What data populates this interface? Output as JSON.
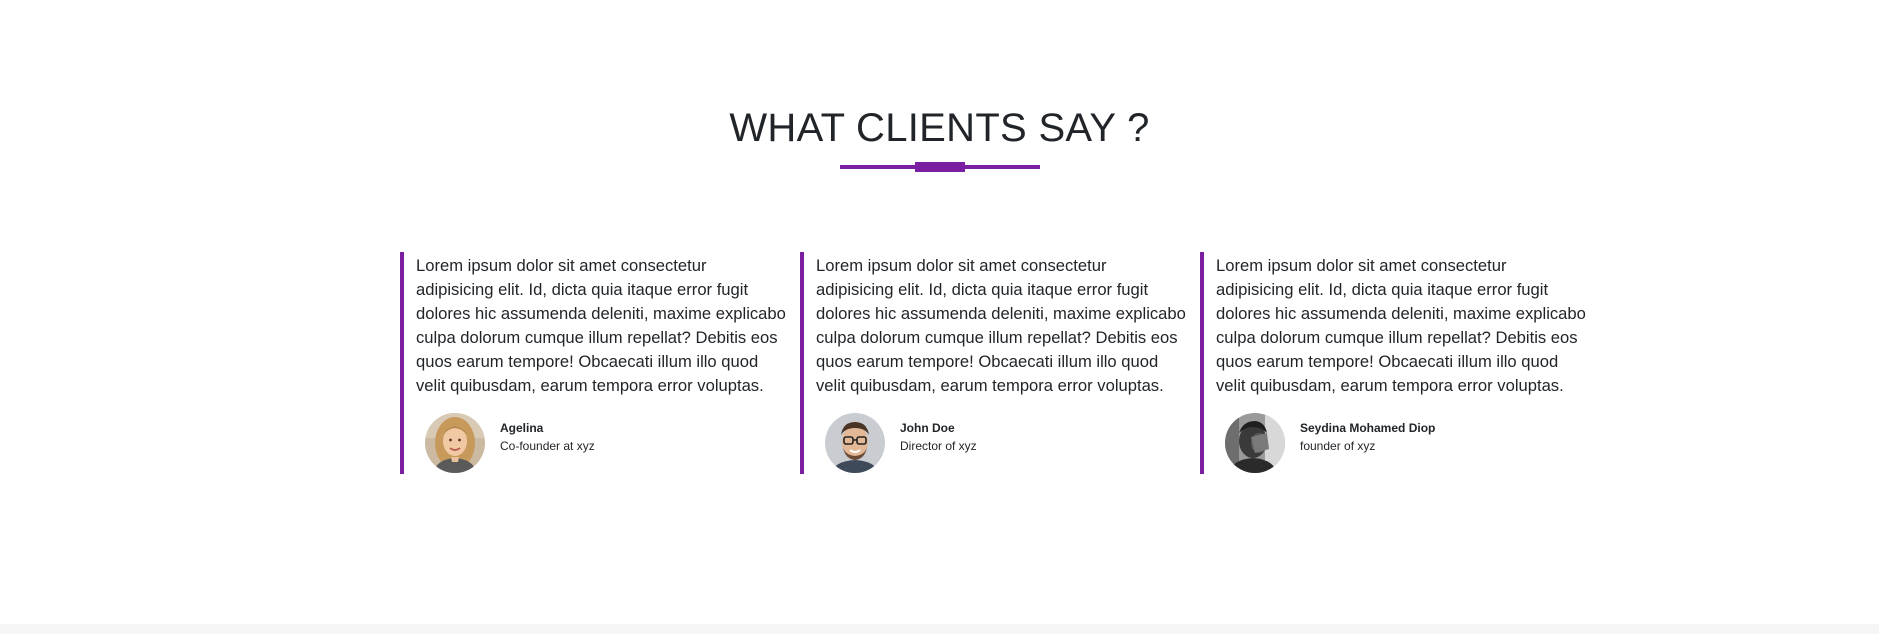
{
  "section": {
    "title": "WHAT CLIENTS SAY ?",
    "accent_color": "#7b1fa2"
  },
  "testimonials": [
    {
      "quote": "Lorem ipsum dolor sit amet consectetur adipisicing elit. Id, dicta quia itaque error fugit dolores hic assumenda deleniti, maxime explicabo culpa dolorum cumque illum repellat? Debitis eos quos earum tempore! Obcaecati illum illo quod velit quibusdam, earum tempora error voluptas.",
      "name": "Agelina",
      "role": "Co-founder at xyz",
      "avatar": "woman-portrait"
    },
    {
      "quote": "Lorem ipsum dolor sit amet consectetur adipisicing elit. Id, dicta quia itaque error fugit dolores hic assumenda deleniti, maxime explicabo culpa dolorum cumque illum repellat? Debitis eos quos earum tempore! Obcaecati illum illo quod velit quibusdam, earum tempora error voluptas.",
      "name": "John Doe",
      "role": "Director of xyz",
      "avatar": "man-glasses-portrait"
    },
    {
      "quote": "Lorem ipsum dolor sit amet consectetur adipisicing elit. Id, dicta quia itaque error fugit dolores hic assumenda deleniti, maxime explicabo culpa dolorum cumque illum repellat? Debitis eos quos earum tempore! Obcaecati illum illo quod velit quibusdam, earum tempora error voluptas.",
      "name": "Seydina Mohamed Diop",
      "role": "founder of xyz",
      "avatar": "man-grayscale-portrait"
    }
  ]
}
